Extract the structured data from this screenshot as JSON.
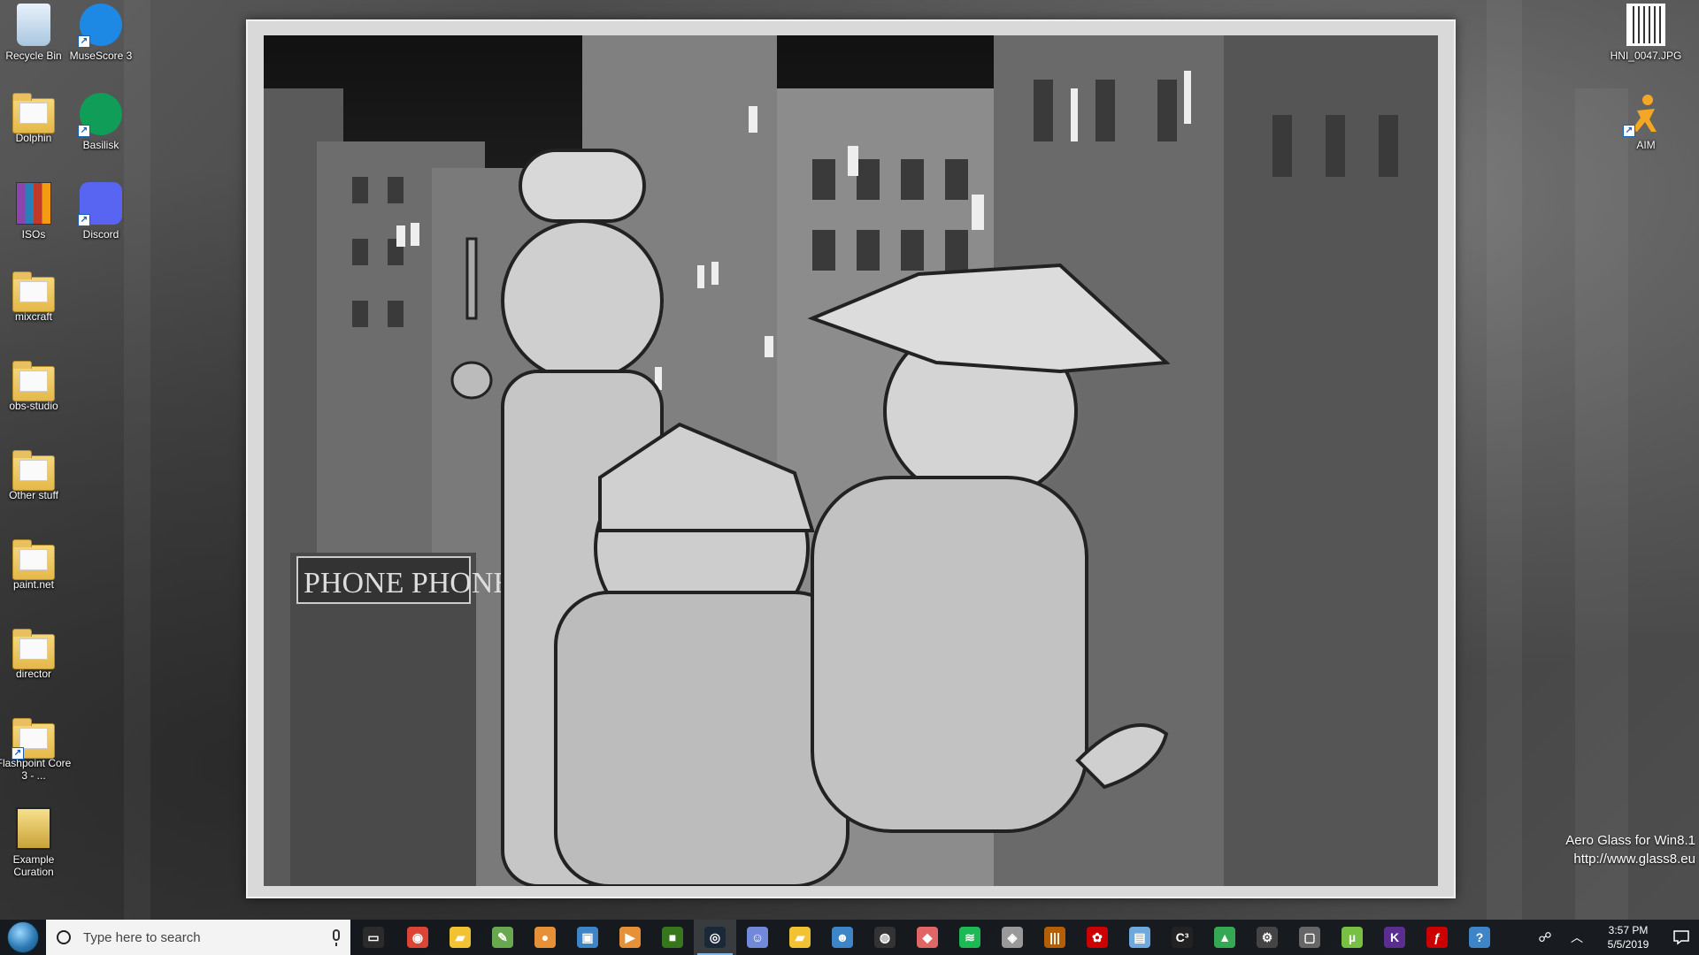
{
  "desktop": {
    "left_icons": [
      {
        "label": "Recycle Bin",
        "icon": "recycle-bin-icon",
        "type": "recycle"
      },
      {
        "label": "Dolphin",
        "icon": "folder-icon",
        "type": "folder"
      },
      {
        "label": "ISOs",
        "icon": "winrar-archive-icon",
        "type": "archive"
      },
      {
        "label": "mixcraft",
        "icon": "folder-icon",
        "type": "folder"
      },
      {
        "label": "obs-studio",
        "icon": "folder-icon",
        "type": "folder"
      },
      {
        "label": "Other stuff",
        "icon": "folder-icon",
        "type": "folder"
      },
      {
        "label": "paint.net",
        "icon": "folder-icon",
        "type": "folder"
      },
      {
        "label": "director",
        "icon": "folder-icon",
        "type": "folder"
      },
      {
        "label": "Flashpoint Core 3 - ...",
        "icon": "folder-shortcut-icon",
        "type": "folder"
      },
      {
        "label": "Example Curation",
        "icon": "curation-icon",
        "type": "curation"
      }
    ],
    "second_column_icons": [
      {
        "label": "MuseScore 3",
        "icon": "musescore-icon"
      },
      {
        "label": "Basilisk",
        "icon": "basilisk-icon"
      },
      {
        "label": "Discord",
        "icon": "discord-icon"
      }
    ],
    "right_icons": [
      {
        "label": "HNI_0047.JPG",
        "icon": "qr-image-icon"
      },
      {
        "label": "AIM",
        "icon": "aim-icon"
      }
    ]
  },
  "watermark": {
    "line1": "Aero Glass for Win8.1",
    "line2": "http://www.glass8.eu"
  },
  "artwork": {
    "sign_text": "PHONE PHONE"
  },
  "taskbar": {
    "search_placeholder": "Type here to search",
    "pinned": [
      {
        "name": "task-view-icon",
        "color": "#2b2b2b",
        "glyph": "▭"
      },
      {
        "name": "chrome-icon",
        "color": "#db4437",
        "glyph": "◉"
      },
      {
        "name": "file-explorer-icon",
        "color": "#f1c232",
        "glyph": "▰"
      },
      {
        "name": "notepad-plus-icon",
        "color": "#6aa84f",
        "glyph": "✎"
      },
      {
        "name": "game-icon",
        "color": "#e69138",
        "glyph": "●"
      },
      {
        "name": "monitor-app-icon",
        "color": "#3d85c6",
        "glyph": "▣"
      },
      {
        "name": "media-player-icon",
        "color": "#e69138",
        "glyph": "▶"
      },
      {
        "name": "minecraft-icon",
        "color": "#38761d",
        "glyph": "■"
      },
      {
        "name": "steam-icon",
        "color": "#1b2838",
        "glyph": "◎"
      },
      {
        "name": "discord-app-icon",
        "color": "#7289da",
        "glyph": "☺"
      },
      {
        "name": "folder-app-icon",
        "color": "#f1c232",
        "glyph": "▰"
      },
      {
        "name": "people-icon",
        "color": "#3d85c6",
        "glyph": "☻"
      },
      {
        "name": "obs-icon",
        "color": "#333333",
        "glyph": "◍"
      },
      {
        "name": "location-icon",
        "color": "#e06666",
        "glyph": "◆"
      },
      {
        "name": "spotify-icon",
        "color": "#1db954",
        "glyph": "≋"
      },
      {
        "name": "shield-icon",
        "color": "#999999",
        "glyph": "◈"
      },
      {
        "name": "audio-editor-icon",
        "color": "#b45f06",
        "glyph": "|||"
      },
      {
        "name": "paint-icon",
        "color": "#cc0000",
        "glyph": "✿"
      },
      {
        "name": "screen-tool-icon",
        "color": "#6fa8dc",
        "glyph": "▤"
      },
      {
        "name": "c3-icon",
        "color": "#222222",
        "glyph": "C³"
      },
      {
        "name": "google-drive-icon",
        "color": "#34a853",
        "glyph": "▲"
      },
      {
        "name": "settings-gear-icon",
        "color": "#444444",
        "glyph": "⚙"
      },
      {
        "name": "window-icon",
        "color": "#666666",
        "glyph": "▢"
      },
      {
        "name": "utorrent-icon",
        "color": "#78c043",
        "glyph": "µ"
      },
      {
        "name": "visual-studio-icon",
        "color": "#5c2d91",
        "glyph": "K"
      },
      {
        "name": "flash-icon",
        "color": "#cc0000",
        "glyph": "ƒ"
      },
      {
        "name": "help-icon",
        "color": "#3d85c6",
        "glyph": "?"
      }
    ],
    "active_index": 8,
    "tray": {
      "time": "3:57 PM",
      "date": "5/5/2019"
    }
  }
}
